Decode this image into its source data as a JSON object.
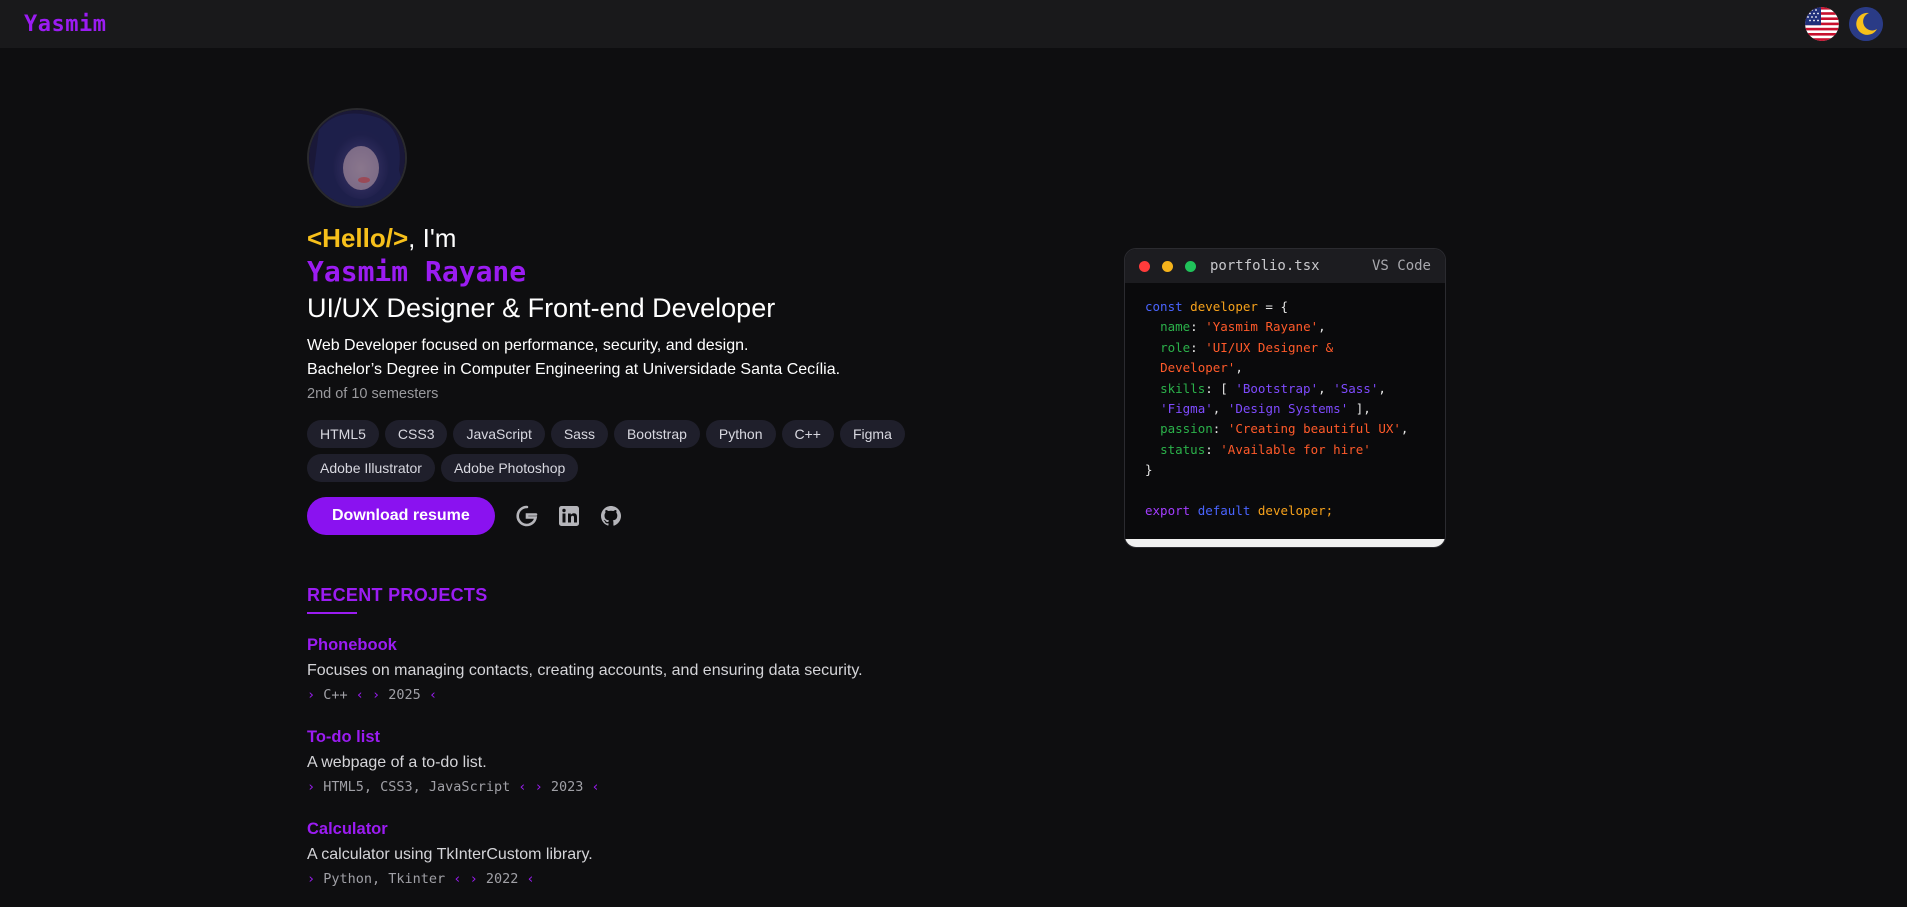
{
  "brand": "Yasmim",
  "header": {
    "hello_tag": "<Hello/>",
    "hello_rest": ", I'm",
    "name": "Yasmim Rayane",
    "role": "UI/UX Designer & Front-end Developer",
    "desc_line1": "Web Developer focused on performance, security, and design.",
    "desc_line2": "Bachelor’s Degree in Computer Engineering at Universidade Santa Cecília.",
    "semester": "2nd of 10 semesters"
  },
  "skills": [
    "HTML5",
    "CSS3",
    "JavaScript",
    "Sass",
    "Bootstrap",
    "Python",
    "C++",
    "Figma",
    "Adobe Illustrator",
    "Adobe Photoshop"
  ],
  "actions": {
    "download_label": "Download resume",
    "social_icons": [
      "google-icon",
      "linkedin-icon",
      "github-icon"
    ]
  },
  "projects_section": {
    "title": "RECENT PROJECTS",
    "items": [
      {
        "title": "Phonebook",
        "desc": "Focuses on managing contacts, creating accounts, and ensuring data security.",
        "tech": "C++",
        "year": "2025"
      },
      {
        "title": "To-do list",
        "desc": "A webpage of a to-do list.",
        "tech": "HTML5, CSS3, JavaScript",
        "year": "2023"
      },
      {
        "title": "Calculator",
        "desc": "A calculator using TkInterCustom library.",
        "tech": "Python, Tkinter",
        "year": "2022"
      }
    ]
  },
  "code_window": {
    "filename": "portfolio.tsx",
    "editor": "VS Code",
    "kw_const": "const",
    "var_name": "developer",
    "props": {
      "name_key": "name",
      "name_val": "'Yasmim Rayane'",
      "role_key": "role",
      "role_val_1": "'UI/UX Designer &",
      "role_val_2": "Developer'",
      "skills_key": "skills",
      "skills_1": "'Bootstrap'",
      "skills_2": "'Sass'",
      "skills_3": "'Figma'",
      "skills_4": "'Design Systems'",
      "passion_key": "passion",
      "passion_val": "'Creating beautiful UX'",
      "status_key": "status",
      "status_val": "'Available for hire'"
    },
    "export_kw": "export",
    "default_kw": "default",
    "export_var": "developer;"
  },
  "colors": {
    "accent": "#9b1cf2",
    "hello_yellow": "#f7c01b",
    "background": "#0e0e10"
  }
}
